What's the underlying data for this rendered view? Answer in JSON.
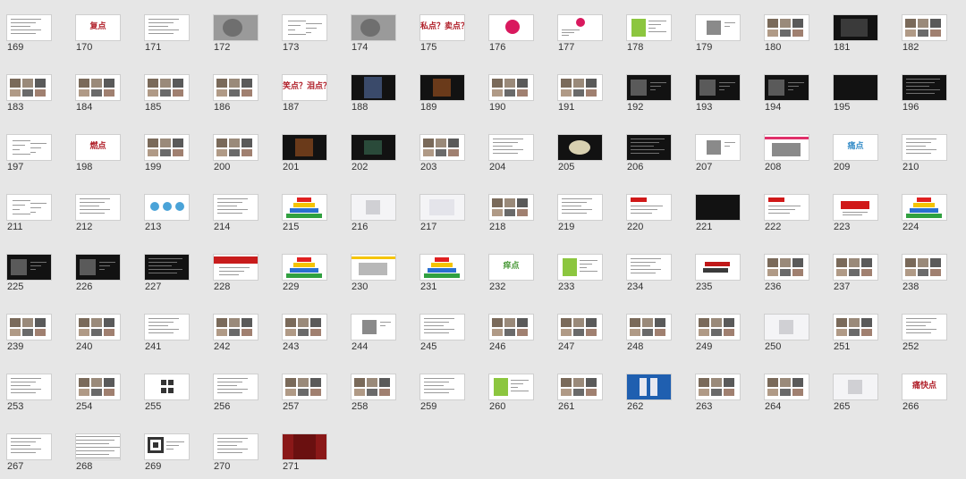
{
  "screen": {
    "background": "#e6e6e6",
    "description_icon": "slide-sorter-grid"
  },
  "slides": [
    {
      "num": "169",
      "style": "text"
    },
    {
      "num": "170",
      "style": "title",
      "title": "复点"
    },
    {
      "num": "171",
      "style": "text"
    },
    {
      "num": "172",
      "style": "photo-gray"
    },
    {
      "num": "173",
      "style": "mindmap"
    },
    {
      "num": "174",
      "style": "photo-gray"
    },
    {
      "num": "175",
      "style": "title",
      "title": "私点？卖点？"
    },
    {
      "num": "176",
      "style": "pink-circle"
    },
    {
      "num": "177",
      "style": "pink-circle-small"
    },
    {
      "num": "178",
      "style": "green-panel"
    },
    {
      "num": "179",
      "style": "photo-small"
    },
    {
      "num": "180",
      "style": "photos"
    },
    {
      "num": "181",
      "style": "photo-dark"
    },
    {
      "num": "182",
      "style": "photos"
    },
    {
      "num": "183",
      "style": "photos"
    },
    {
      "num": "184",
      "style": "photos"
    },
    {
      "num": "185",
      "style": "photos"
    },
    {
      "num": "186",
      "style": "photos"
    },
    {
      "num": "187",
      "style": "title",
      "title": "笑点？泪点？"
    },
    {
      "num": "188",
      "style": "dark-glow"
    },
    {
      "num": "189",
      "style": "dark-warm"
    },
    {
      "num": "190",
      "style": "photos"
    },
    {
      "num": "191",
      "style": "photos"
    },
    {
      "num": "192",
      "style": "dark-photos"
    },
    {
      "num": "193",
      "style": "dark-photos"
    },
    {
      "num": "194",
      "style": "dark-photos"
    },
    {
      "num": "195",
      "style": "dark"
    },
    {
      "num": "196",
      "style": "dark-text"
    },
    {
      "num": "197",
      "style": "mindmap"
    },
    {
      "num": "198",
      "style": "title",
      "title": "燃点"
    },
    {
      "num": "199",
      "style": "photos"
    },
    {
      "num": "200",
      "style": "photos"
    },
    {
      "num": "201",
      "style": "dark-warm"
    },
    {
      "num": "202",
      "style": "dark-green"
    },
    {
      "num": "203",
      "style": "photos"
    },
    {
      "num": "204",
      "style": "text"
    },
    {
      "num": "205",
      "style": "dark-object"
    },
    {
      "num": "206",
      "style": "dark-text"
    },
    {
      "num": "207",
      "style": "photo-small"
    },
    {
      "num": "208",
      "style": "pink-bar"
    },
    {
      "num": "209",
      "style": "title-blue",
      "title": "痛点"
    },
    {
      "num": "210",
      "style": "text"
    },
    {
      "num": "211",
      "style": "mindmap"
    },
    {
      "num": "212",
      "style": "text"
    },
    {
      "num": "213",
      "style": "blue-circles"
    },
    {
      "num": "214",
      "style": "text"
    },
    {
      "num": "215",
      "style": "pyramid"
    },
    {
      "num": "216",
      "style": "light-object"
    },
    {
      "num": "217",
      "style": "light"
    },
    {
      "num": "218",
      "style": "photos"
    },
    {
      "num": "219",
      "style": "text"
    },
    {
      "num": "220",
      "style": "red-bar"
    },
    {
      "num": "221",
      "style": "dark"
    },
    {
      "num": "222",
      "style": "red-bar"
    },
    {
      "num": "223",
      "style": "red-title"
    },
    {
      "num": "224",
      "style": "pyramid"
    },
    {
      "num": "225",
      "style": "dark-photos"
    },
    {
      "num": "226",
      "style": "dark-photos"
    },
    {
      "num": "227",
      "style": "dark-text"
    },
    {
      "num": "228",
      "style": "red-band"
    },
    {
      "num": "229",
      "style": "pyramid"
    },
    {
      "num": "230",
      "style": "car"
    },
    {
      "num": "231",
      "style": "pyramid"
    },
    {
      "num": "232",
      "style": "title-green",
      "title": "痒点"
    },
    {
      "num": "233",
      "style": "green-panel"
    },
    {
      "num": "234",
      "style": "text"
    },
    {
      "num": "235",
      "style": "red-objects"
    },
    {
      "num": "236",
      "style": "photos"
    },
    {
      "num": "237",
      "style": "photos"
    },
    {
      "num": "238",
      "style": "photos"
    },
    {
      "num": "239",
      "style": "photos"
    },
    {
      "num": "240",
      "style": "photos"
    },
    {
      "num": "241",
      "style": "text"
    },
    {
      "num": "242",
      "style": "photos"
    },
    {
      "num": "243",
      "style": "photos"
    },
    {
      "num": "244",
      "style": "photo-small"
    },
    {
      "num": "245",
      "style": "text"
    },
    {
      "num": "246",
      "style": "photos"
    },
    {
      "num": "247",
      "style": "photos"
    },
    {
      "num": "248",
      "style": "photos"
    },
    {
      "num": "249",
      "style": "photos"
    },
    {
      "num": "250",
      "style": "light-object"
    },
    {
      "num": "251",
      "style": "photos"
    },
    {
      "num": "252",
      "style": "text"
    },
    {
      "num": "253",
      "style": "text"
    },
    {
      "num": "254",
      "style": "photos"
    },
    {
      "num": "255",
      "style": "qr-chars"
    },
    {
      "num": "256",
      "style": "text"
    },
    {
      "num": "257",
      "style": "photos"
    },
    {
      "num": "258",
      "style": "photos"
    },
    {
      "num": "259",
      "style": "text"
    },
    {
      "num": "260",
      "style": "green-panel"
    },
    {
      "num": "261",
      "style": "photos"
    },
    {
      "num": "262",
      "style": "blue"
    },
    {
      "num": "263",
      "style": "photos"
    },
    {
      "num": "264",
      "style": "photos"
    },
    {
      "num": "265",
      "style": "light-object"
    },
    {
      "num": "266",
      "style": "title",
      "title": "痛快点"
    },
    {
      "num": "267",
      "style": "text"
    },
    {
      "num": "268",
      "style": "lines"
    },
    {
      "num": "269",
      "style": "qr"
    },
    {
      "num": "270",
      "style": "text"
    },
    {
      "num": "271",
      "style": "curtain"
    }
  ]
}
